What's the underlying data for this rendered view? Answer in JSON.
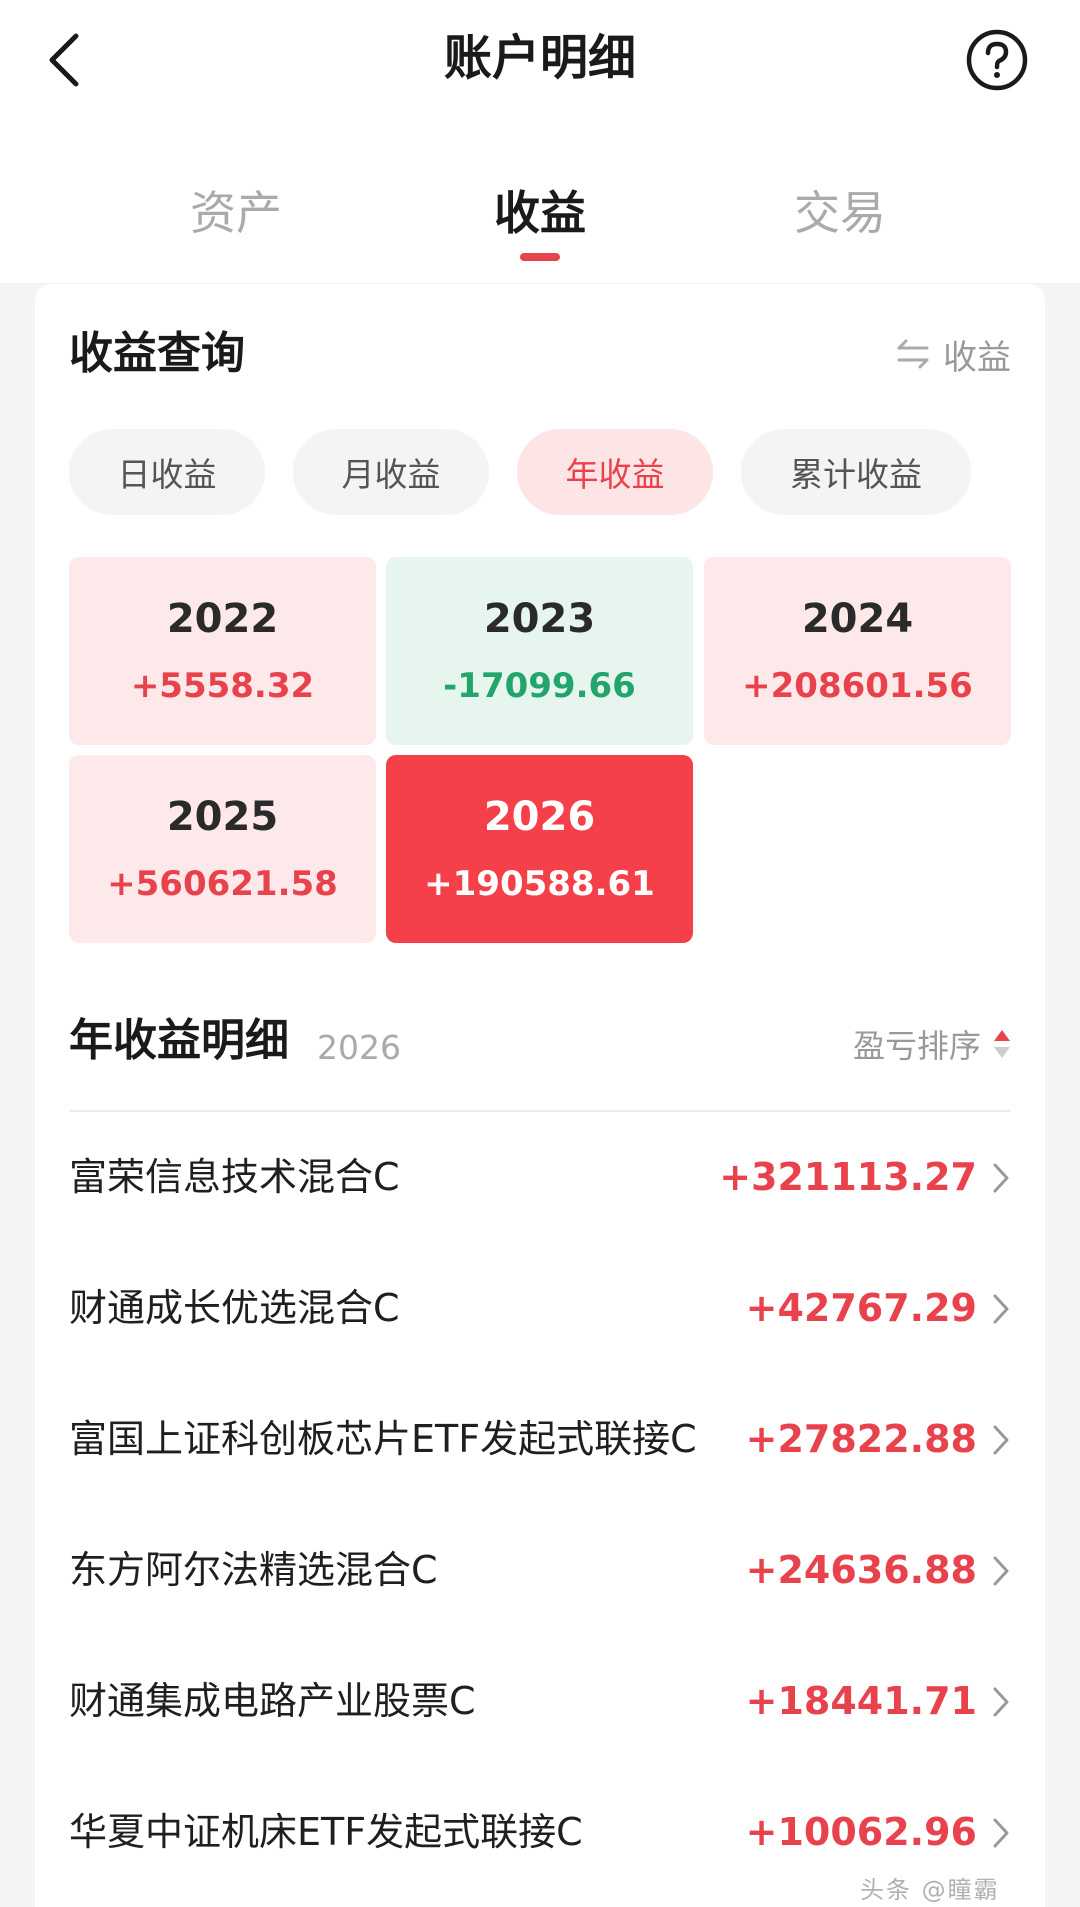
{
  "nav": {
    "title": "账户明细",
    "back_icon": "chevron-left-icon",
    "help_icon": "question-circle-icon"
  },
  "tabs": [
    {
      "label": "资产",
      "active": false
    },
    {
      "label": "收益",
      "active": true
    },
    {
      "label": "交易",
      "active": false
    }
  ],
  "query": {
    "title": "收益查询",
    "switch_label": "收益",
    "switch_icon": "swap-arrows-icon"
  },
  "chips": [
    {
      "label": "日收益",
      "active": false
    },
    {
      "label": "月收益",
      "active": false
    },
    {
      "label": "年收益",
      "active": true
    },
    {
      "label": "累计收益",
      "active": false
    }
  ],
  "years": [
    {
      "year": "2022",
      "value": "+5558.32",
      "state": "pos"
    },
    {
      "year": "2023",
      "value": "-17099.66",
      "state": "neg"
    },
    {
      "year": "2024",
      "value": "+208601.56",
      "state": "pos"
    },
    {
      "year": "2025",
      "value": "+560621.58",
      "state": "pos"
    },
    {
      "year": "2026",
      "value": "+190588.61",
      "state": "selected"
    }
  ],
  "detail": {
    "title": "年收益明细",
    "year": "2026",
    "sort_label": "盈亏排序",
    "sort_icon": "sort-caret-icon"
  },
  "funds": [
    {
      "name": "富荣信息技术混合C",
      "value": "+321113.27"
    },
    {
      "name": "财通成长优选混合C",
      "value": "+42767.29"
    },
    {
      "name": "富国上证科创板芯片ETF发起式联接C",
      "value": "+27822.88"
    },
    {
      "name": "东方阿尔法精选混合C",
      "value": "+24636.88"
    },
    {
      "name": "财通集成电路产业股票C",
      "value": "+18441.71"
    },
    {
      "name": "华夏中证机床ETF发起式联接C",
      "value": "+10062.96"
    }
  ],
  "watermark": "头条 @瞳霸",
  "colors": {
    "accent": "#e8424c",
    "positive_bg": "#fde9ea",
    "negative": "#21a56a",
    "negative_bg": "#e6f5ee",
    "selected_bg": "#f5404a"
  }
}
